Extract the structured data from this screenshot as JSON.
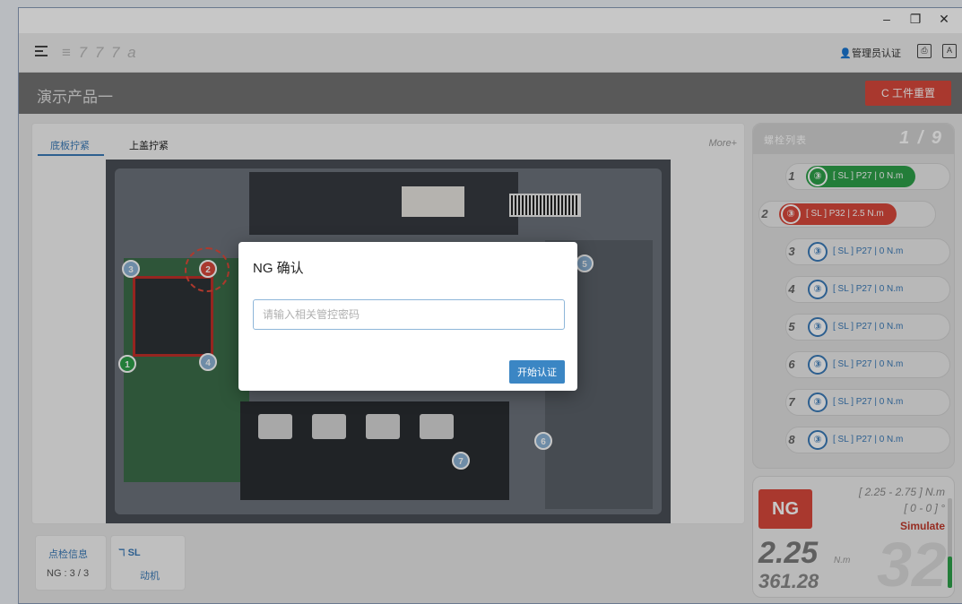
{
  "window": {
    "minimize": "–",
    "maximize": "❐",
    "close": "✕"
  },
  "toolbar": {
    "app_code": "≡ 7 7 7 a",
    "auth_label": "管理员认证",
    "icon_names": [
      "menu-icon",
      "user-icon",
      "print-icon",
      "keyboard-icon"
    ]
  },
  "product": {
    "title": "演示产品一",
    "reset_label": "C 工件重置"
  },
  "work_tabs": [
    {
      "label": "底板拧紧"
    },
    {
      "label": "上盖拧紧"
    }
  ],
  "more_label": "More+",
  "markers": [
    {
      "num": "1"
    },
    {
      "num": "2"
    },
    {
      "num": "3"
    },
    {
      "num": "4"
    },
    {
      "num": "5"
    },
    {
      "num": "6"
    },
    {
      "num": "7"
    }
  ],
  "inspection": {
    "title": "点检信息",
    "value": "NG : 3 / 3"
  },
  "tool": {
    "title": "ℸ SL",
    "value": "动机"
  },
  "bolt_panel": {
    "title": "螺栓列表",
    "count": "1 / 9"
  },
  "bolts": [
    {
      "num": "1",
      "icon": "③",
      "label": "[ SL ] P27 | 0 N.m",
      "status": "ok"
    },
    {
      "num": "2",
      "icon": "③",
      "label": "[ SL ] P32 | 2.5 N.m",
      "status": "ng"
    },
    {
      "num": "3",
      "icon": "③",
      "label": "[ SL ] P27 | 0 N.m",
      "status": "pending"
    },
    {
      "num": "4",
      "icon": "③",
      "label": "[ SL ] P27 | 0 N.m",
      "status": "pending"
    },
    {
      "num": "5",
      "icon": "③",
      "label": "[ SL ] P27 | 0 N.m",
      "status": "pending"
    },
    {
      "num": "6",
      "icon": "③",
      "label": "[ SL ] P27 | 0 N.m",
      "status": "pending"
    },
    {
      "num": "7",
      "icon": "③",
      "label": "[ SL ] P27 | 0 N.m",
      "status": "pending"
    },
    {
      "num": "8",
      "icon": "③",
      "label": "[ SL ] P27 | 0 N.m",
      "status": "pending"
    }
  ],
  "result": {
    "status": "NG",
    "torque_range": "[ 2.25 - 2.75 ] N.m",
    "angle_range": "[ 0 - 0 ] °",
    "mode": "Simulate",
    "big_count": "32",
    "torque": "2.25",
    "torque_unit": "N.m",
    "angle": "361.28",
    "progress_percent": 35
  },
  "modal": {
    "title": "NG 确认",
    "input_placeholder": "请输入相关管控密码",
    "input_value": "",
    "submit_label": "开始认证"
  },
  "colors": {
    "accent_blue": "#3a7ab8",
    "ok_green": "#2ea04a",
    "ng_red": "#d9483b"
  }
}
